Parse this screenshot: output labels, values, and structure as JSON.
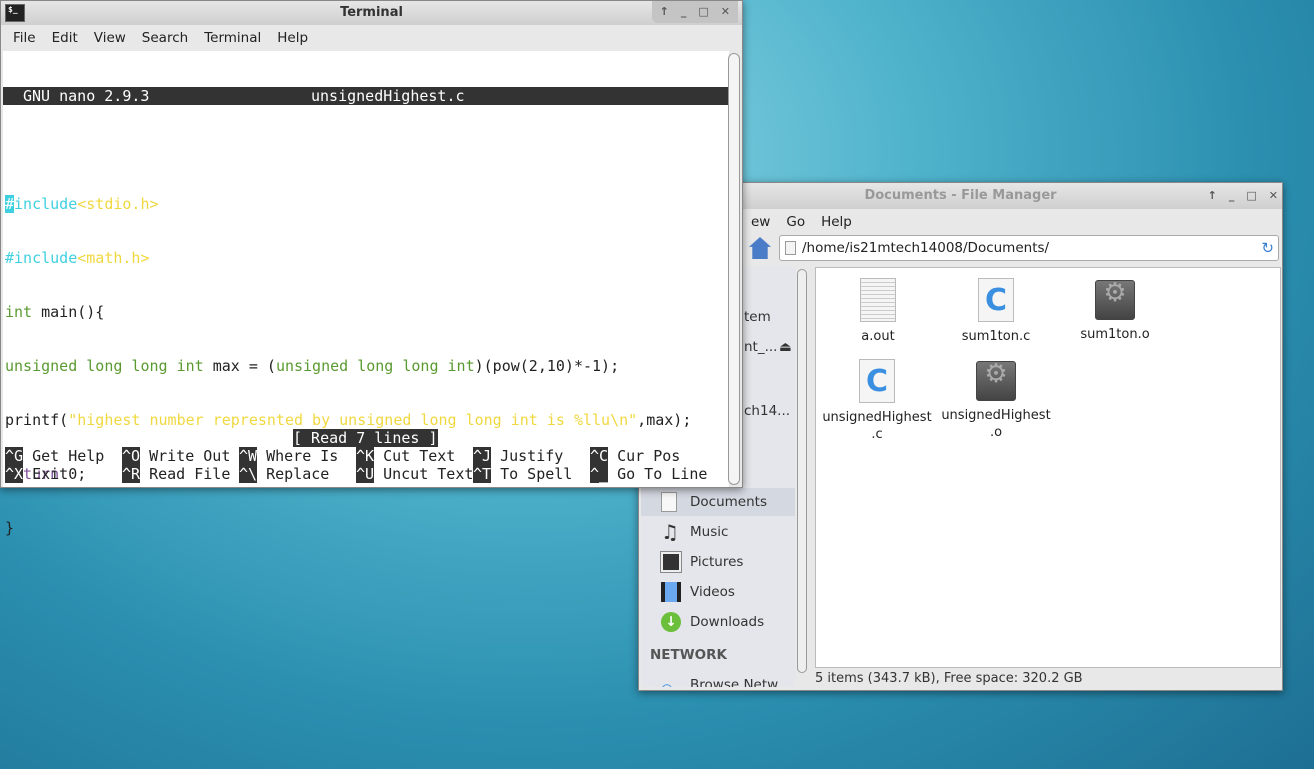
{
  "terminal": {
    "title": "Terminal",
    "icon": "terminal-icon",
    "menu": [
      "File",
      "Edit",
      "View",
      "Search",
      "Terminal",
      "Help"
    ],
    "nano_version": "GNU nano 2.9.3",
    "filename": "unsignedHighest.c",
    "code": {
      "l1_hash": "#",
      "l1_kw": "include",
      "l1_hdr": "<stdio.h>",
      "l2_kw": "#include",
      "l2_hdr": "<math.h>",
      "l3_type": "int",
      "l3_rest": " main(){",
      "l4_t1": "unsigned long long int",
      "l4_m1": " max = (",
      "l4_t2": "unsigned long long int",
      "l4_m2": ")(pow(2,10)*-1);",
      "l5_a": "printf(",
      "l5_str": "\"highest number represnted by unsigned long long int is %llu\\n\"",
      "l5_b": ",max);",
      "l6_kw": "return",
      "l6_rest": " 0;",
      "l7": "}"
    },
    "status": "[ Read 7 lines ]",
    "shortcuts": [
      {
        "key": "^G",
        "label": "Get Help"
      },
      {
        "key": "^O",
        "label": "Write Out"
      },
      {
        "key": "^W",
        "label": "Where Is"
      },
      {
        "key": "^K",
        "label": "Cut Text"
      },
      {
        "key": "^J",
        "label": "Justify"
      },
      {
        "key": "^C",
        "label": "Cur Pos"
      },
      {
        "key": "^X",
        "label": "Exit"
      },
      {
        "key": "^R",
        "label": "Read File"
      },
      {
        "key": "^\\",
        "label": "Replace"
      },
      {
        "key": "^U",
        "label": "Uncut Text"
      },
      {
        "key": "^T",
        "label": "To Spell"
      },
      {
        "key": "^_",
        "label": "Go To Line"
      }
    ]
  },
  "file_manager": {
    "title": "Documents - File Manager",
    "menu": [
      "ew",
      "Go",
      "Help"
    ],
    "path": "/home/is21mtech14008/Documents/",
    "sidebar": {
      "partial": [
        "tem",
        "nt_...",
        "ch14..."
      ],
      "items": [
        {
          "label": "Documents",
          "icon": "folder-documents-icon"
        },
        {
          "label": "Music",
          "icon": "music-icon"
        },
        {
          "label": "Pictures",
          "icon": "pictures-icon"
        },
        {
          "label": "Videos",
          "icon": "videos-icon"
        },
        {
          "label": "Downloads",
          "icon": "downloads-icon"
        }
      ],
      "network_header": "NETWORK",
      "browse": "Browse Netw"
    },
    "files": [
      {
        "name": "a.out",
        "type": "text"
      },
      {
        "name": "sum1ton.c",
        "type": "c"
      },
      {
        "name": "sum1ton.o",
        "type": "object"
      },
      {
        "name": "unsignedHighest\n.c",
        "type": "c"
      },
      {
        "name": "unsignedHighest\n.o",
        "type": "object"
      }
    ],
    "status": "5 items (343.7 kB), Free space: 320.2 GB"
  }
}
